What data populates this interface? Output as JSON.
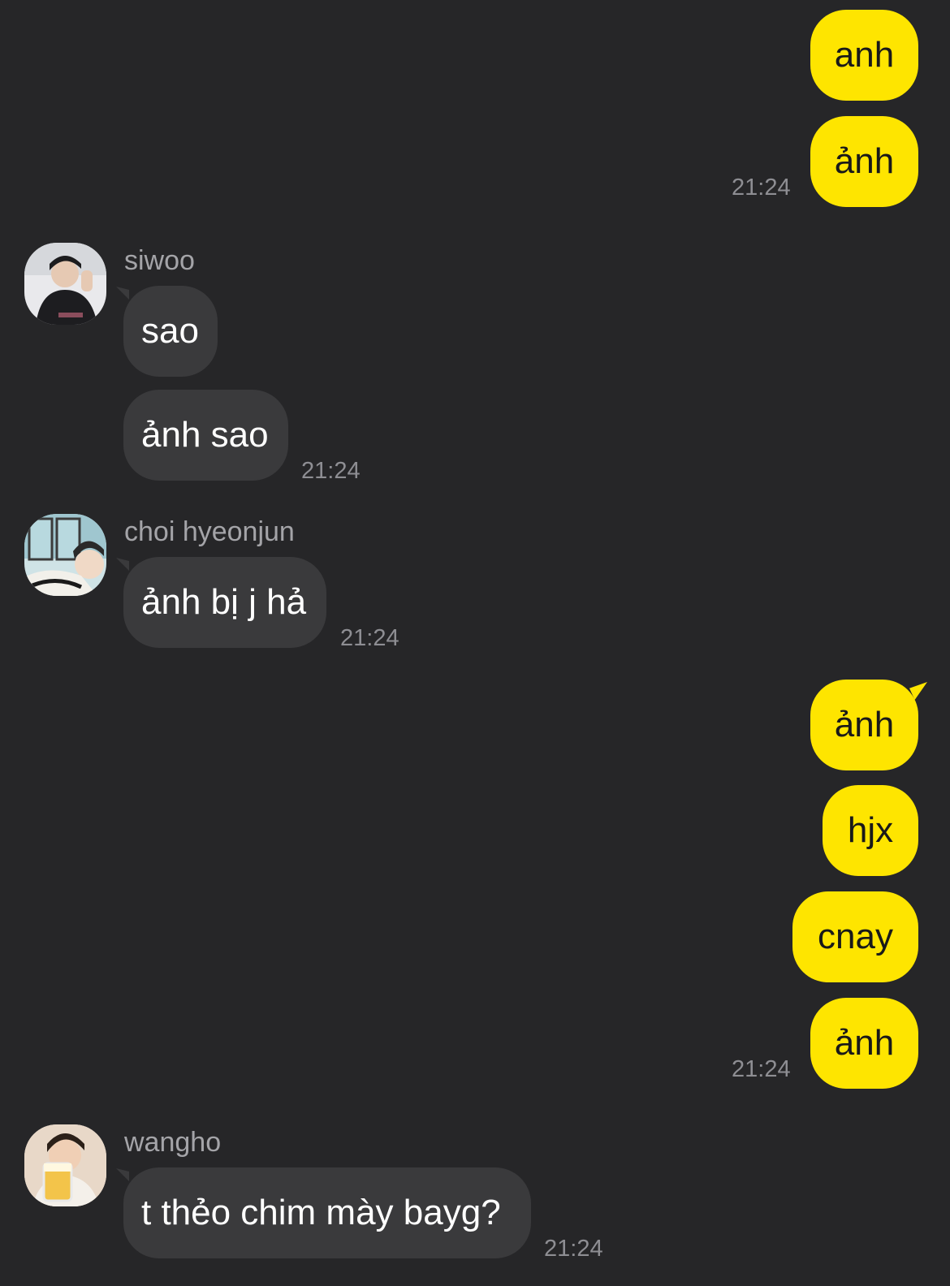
{
  "messages": {
    "m1": {
      "text": "anh"
    },
    "m2": {
      "text": "ảnh",
      "time": "21:24"
    },
    "m3": {
      "sender": "siwoo",
      "text": "sao"
    },
    "m4": {
      "text": "ảnh sao",
      "time": "21:24"
    },
    "m5": {
      "sender": "choi hyeonjun",
      "text": "ảnh bị j hả",
      "time": "21:24"
    },
    "m6": {
      "text": "ảnh"
    },
    "m7": {
      "text": "hjx"
    },
    "m8": {
      "text": "cnay"
    },
    "m9": {
      "text": "ảnh",
      "time": "21:24"
    },
    "m10": {
      "sender": "wangho",
      "text": "t thẻo chim mày bayg?",
      "time": "21:24"
    }
  },
  "colors": {
    "background": "#262628",
    "my_bubble": "#fee500",
    "their_bubble": "#3a3a3c",
    "timestamp": "#8e8e93",
    "sender_name": "#a4a4a8"
  },
  "icons": {
    "siwoo_avatar": "profile-photo",
    "choi_hyeonjun_avatar": "profile-photo",
    "wangho_avatar": "profile-photo"
  }
}
